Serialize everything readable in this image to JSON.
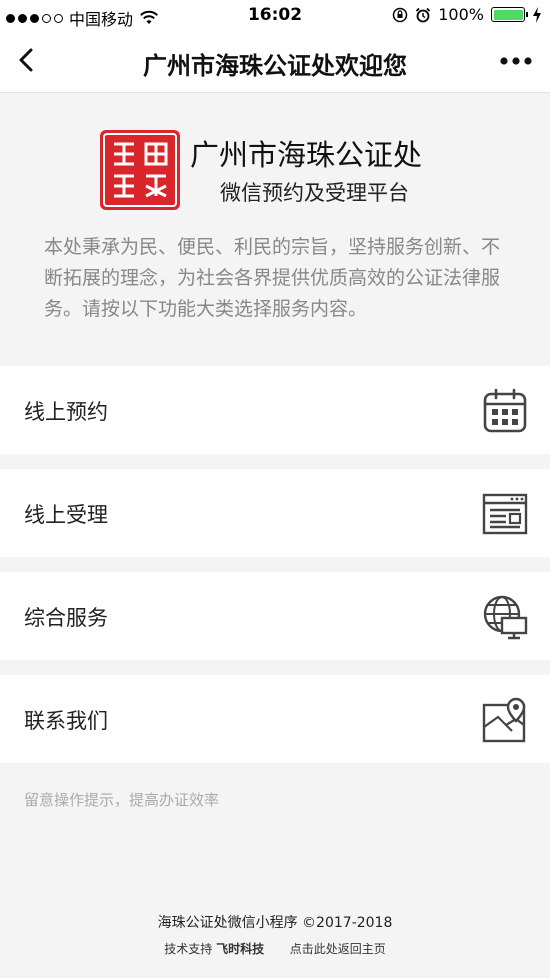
{
  "status_bar": {
    "carrier": "中国移动",
    "time": "16:02",
    "battery": "100%",
    "battery_level": 1.0
  },
  "nav": {
    "title": "广州市海珠公证处欢迎您",
    "back_icon": "back-arrow-icon",
    "more_icon": "more-dots-icon"
  },
  "header": {
    "title": "广州市海珠公证处",
    "subtitle": "微信预约及受理平台",
    "seal_color": "#d8262b"
  },
  "intro": "本处秉承为民、便民、利民的宗旨，坚持服务创新、不断拓展的理念，为社会各界提供优质高效的公证法律服务。请按以下功能大类选择服务内容。",
  "menu": [
    {
      "label": "线上预约",
      "icon": "calendar-icon"
    },
    {
      "label": "线上受理",
      "icon": "browser-window-icon"
    },
    {
      "label": "综合服务",
      "icon": "globe-monitor-icon"
    },
    {
      "label": "联系我们",
      "icon": "map-location-icon"
    }
  ],
  "tip": "留意操作提示，提高办证效率",
  "footer": {
    "line1": "海珠公证处微信小程序 ©2017-2018",
    "support_prefix": "技术支持",
    "support_name": "飞时科技",
    "home_link": "点击此处返回主页"
  }
}
